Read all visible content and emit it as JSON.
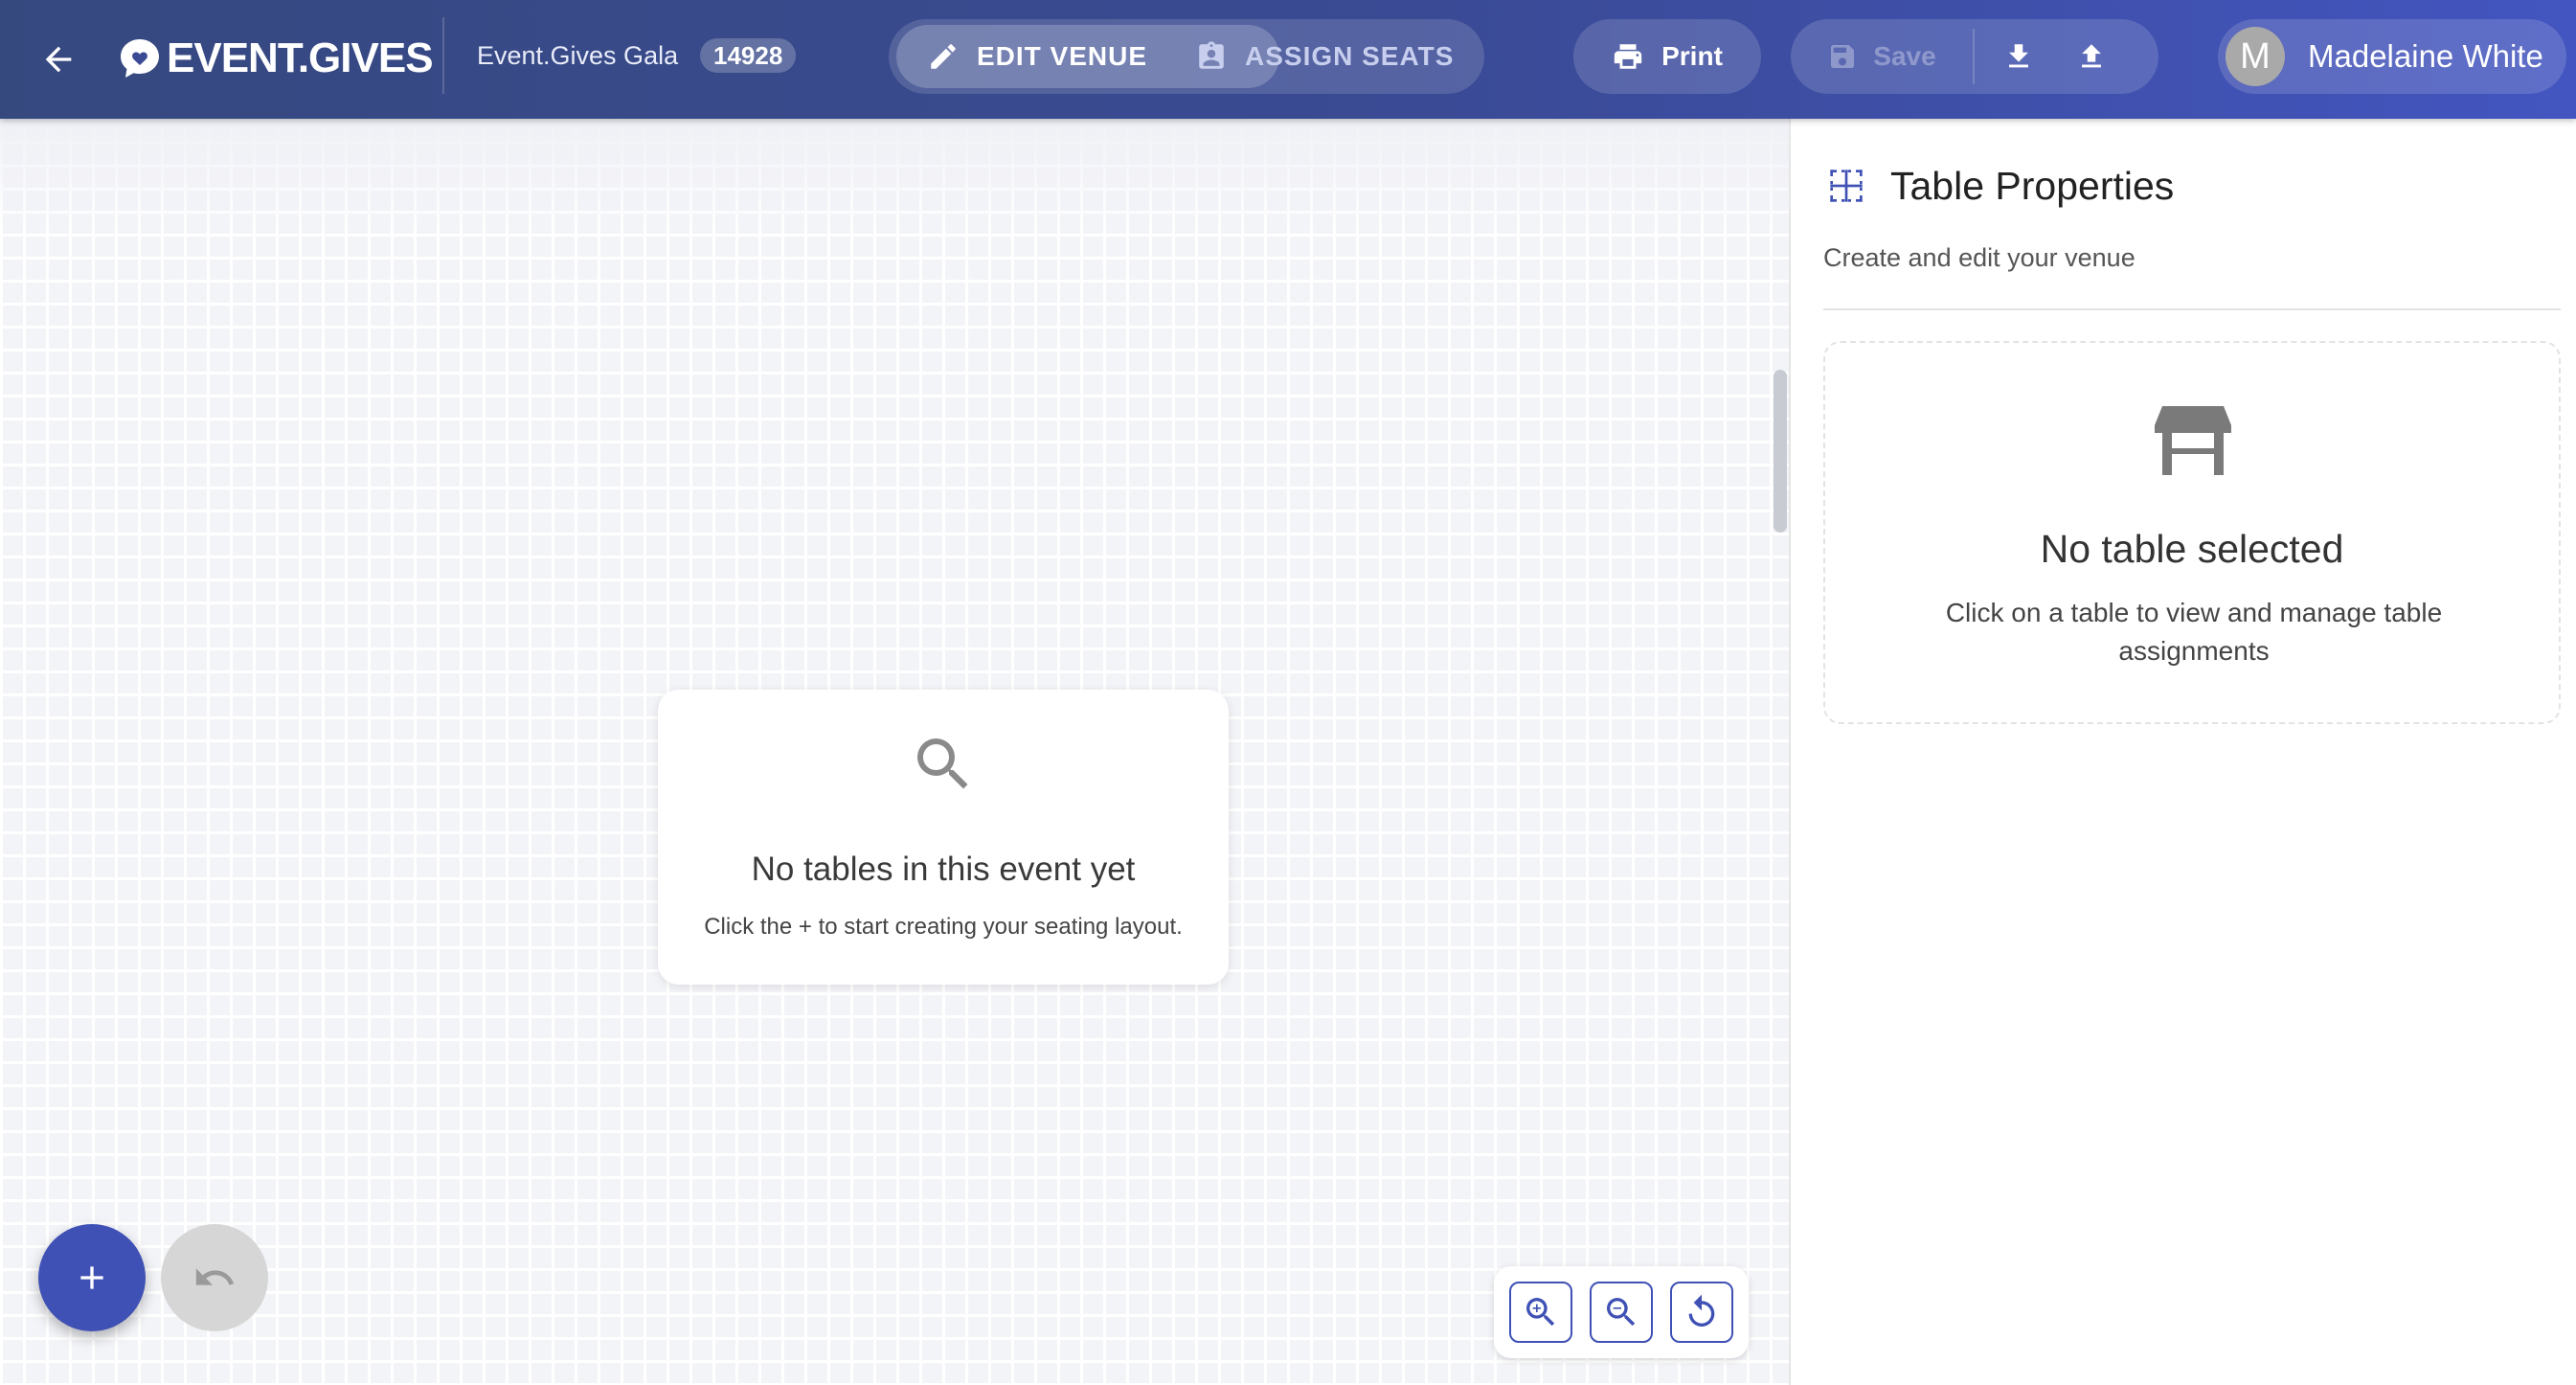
{
  "header": {
    "back_icon": "arrow-left-icon",
    "logo_text": "EVENT.GIVES",
    "event_name": "Event.Gives Gala",
    "event_id": "14928",
    "modes": [
      {
        "label": "EDIT VENUE",
        "icon": "pencil-icon",
        "active": true
      },
      {
        "label": "ASSIGN SEATS",
        "icon": "clipboard-account-icon",
        "active": false
      }
    ],
    "print_label": "Print",
    "save_label": "Save",
    "user": {
      "initial": "M",
      "name": "Madelaine White"
    }
  },
  "canvas": {
    "empty_title": "No tables in this event yet",
    "empty_subtitle": "Click the + to start creating your seating layout.",
    "add_button_icon": "plus-icon",
    "undo_button_icon": "undo-icon",
    "zoom_controls": [
      "zoom-in-icon",
      "zoom-out-icon",
      "reset-icon"
    ]
  },
  "panel": {
    "title": "Table Properties",
    "subtitle": "Create and edit your venue",
    "no_selection_title": "No table selected",
    "no_selection_text": "Click on a table to view and manage table assignments"
  },
  "colors": {
    "header_start": "#36497f",
    "header_end": "#4355c0",
    "accent": "#3f51b5",
    "canvas_bg": "#f3f4f8"
  }
}
